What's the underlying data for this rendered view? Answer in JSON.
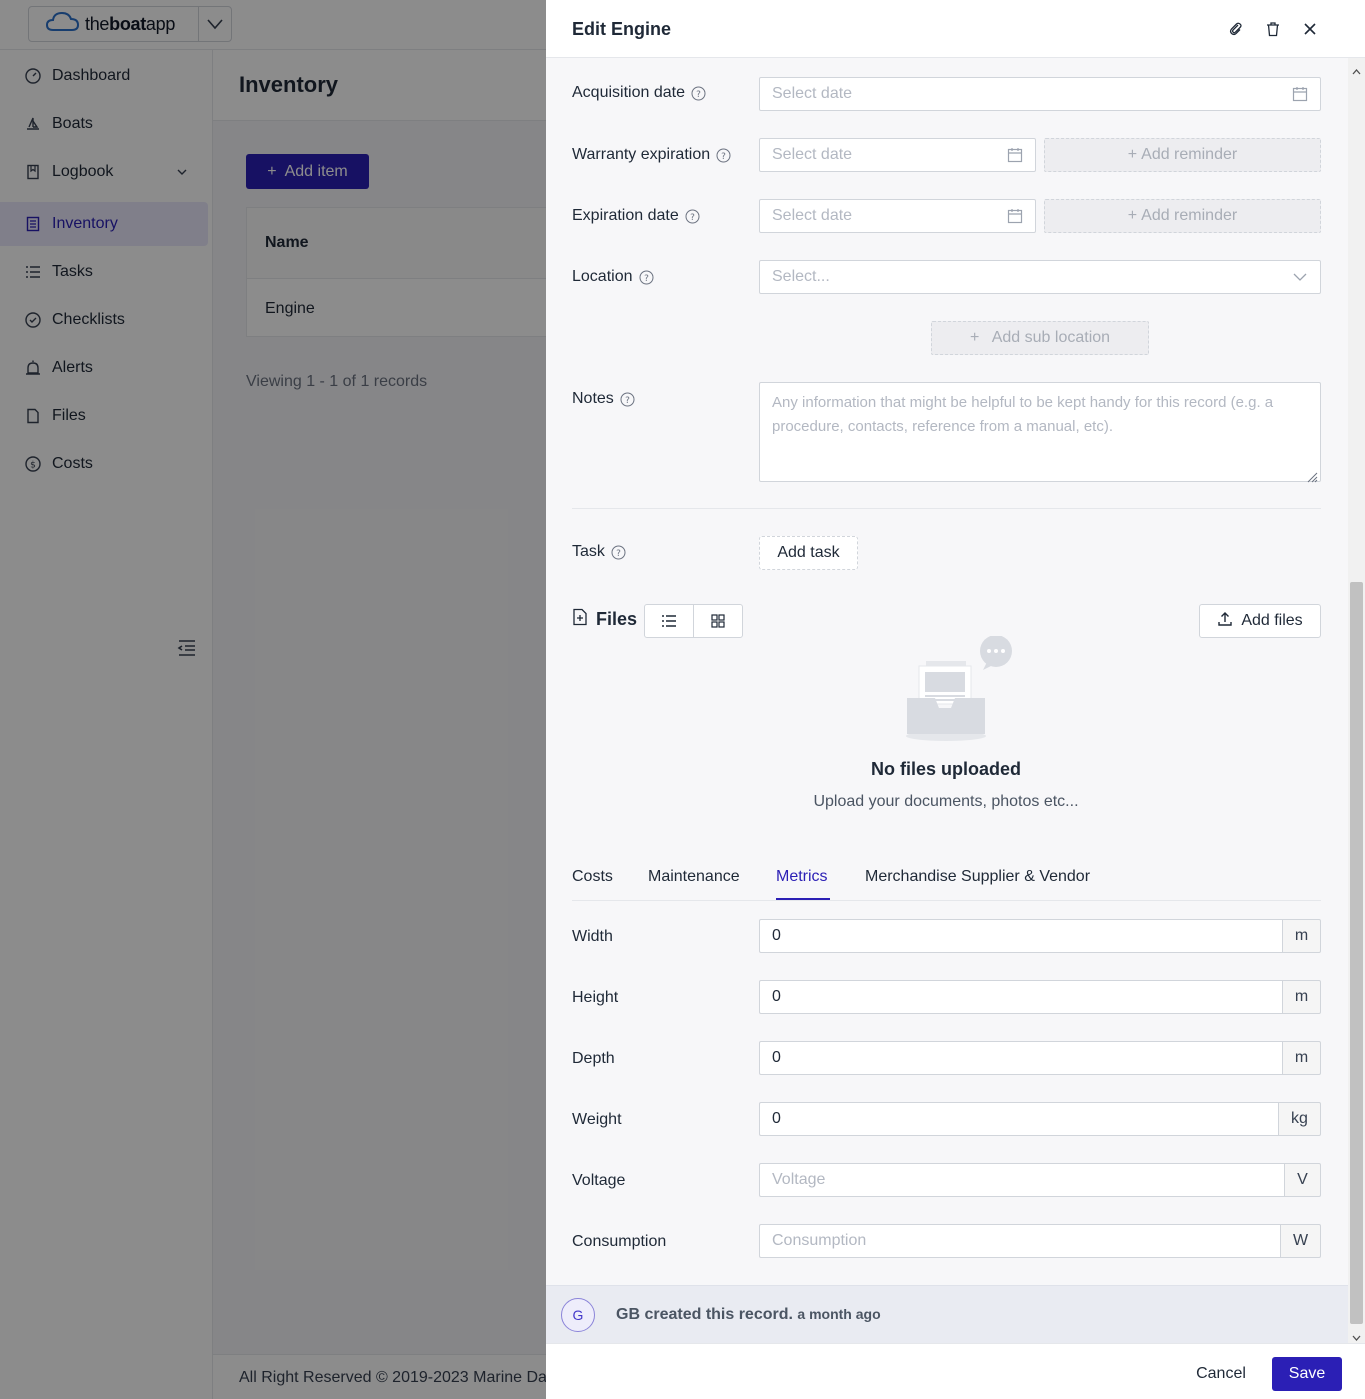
{
  "brand": {
    "prefix": "the",
    "bold": "boat",
    "suffix": "app",
    "icon": "cloud-logo-icon"
  },
  "sidebar": {
    "items": [
      {
        "label": "Dashboard",
        "icon": "dashboard-icon"
      },
      {
        "label": "Boats",
        "icon": "boat-icon"
      },
      {
        "label": "Logbook",
        "icon": "book-icon"
      },
      {
        "label": "Inventory",
        "icon": "inventory-icon",
        "active": true
      },
      {
        "label": "Tasks",
        "icon": "list-icon"
      },
      {
        "label": "Checklists",
        "icon": "check-circle-icon"
      },
      {
        "label": "Alerts",
        "icon": "alarm-icon"
      },
      {
        "label": "Files",
        "icon": "file-icon"
      },
      {
        "label": "Costs",
        "icon": "dollar-icon"
      }
    ]
  },
  "main": {
    "title": "Inventory",
    "add_item_label": "Add item",
    "table": {
      "header_name": "Name",
      "rows": [
        {
          "name": "Engine"
        }
      ]
    },
    "records": "Viewing 1 - 1 of 1 records",
    "footer": "All Right Reserved © 2019-2023 Marine Da"
  },
  "drawer": {
    "title": "Edit Engine",
    "acquisition": {
      "label": "Acquisition date",
      "placeholder": "Select date"
    },
    "warranty": {
      "label": "Warranty expiration",
      "placeholder": "Select date",
      "reminder": "Add reminder"
    },
    "expiration": {
      "label": "Expiration date",
      "placeholder": "Select date",
      "reminder": "Add reminder"
    },
    "location": {
      "label": "Location",
      "placeholder": "Select...",
      "add_sub": "Add sub location"
    },
    "notes": {
      "label": "Notes",
      "placeholder": "Any information that might be helpful to be kept handy for this record (e.g. a procedure, contacts, reference from a manual, etc)."
    },
    "task": {
      "label": "Task",
      "button": "Add task"
    },
    "files": {
      "title": "Files",
      "add_label": "Add files",
      "empty_title": "No files uploaded",
      "empty_sub": "Upload your documents, photos etc..."
    },
    "tabs": [
      "Costs",
      "Maintenance",
      "Metrics",
      "Merchandise Supplier & Vendor"
    ],
    "active_tab": "Metrics",
    "metrics": {
      "width": {
        "label": "Width",
        "value": "0",
        "unit": "m"
      },
      "height": {
        "label": "Height",
        "value": "0",
        "unit": "m"
      },
      "depth": {
        "label": "Depth",
        "value": "0",
        "unit": "m"
      },
      "weight": {
        "label": "Weight",
        "value": "0",
        "unit": "kg"
      },
      "voltage": {
        "label": "Voltage",
        "value": "",
        "placeholder": "Voltage",
        "unit": "V"
      },
      "consumption": {
        "label": "Consumption",
        "value": "",
        "placeholder": "Consumption",
        "unit": "W"
      }
    },
    "created": {
      "avatar": "G",
      "text": "GB created this record.",
      "when": "a month ago"
    },
    "cancel_label": "Cancel",
    "save_label": "Save"
  },
  "colors": {
    "accent": "#2b1fb5",
    "active_nav_bg": "#e9e7fb"
  }
}
